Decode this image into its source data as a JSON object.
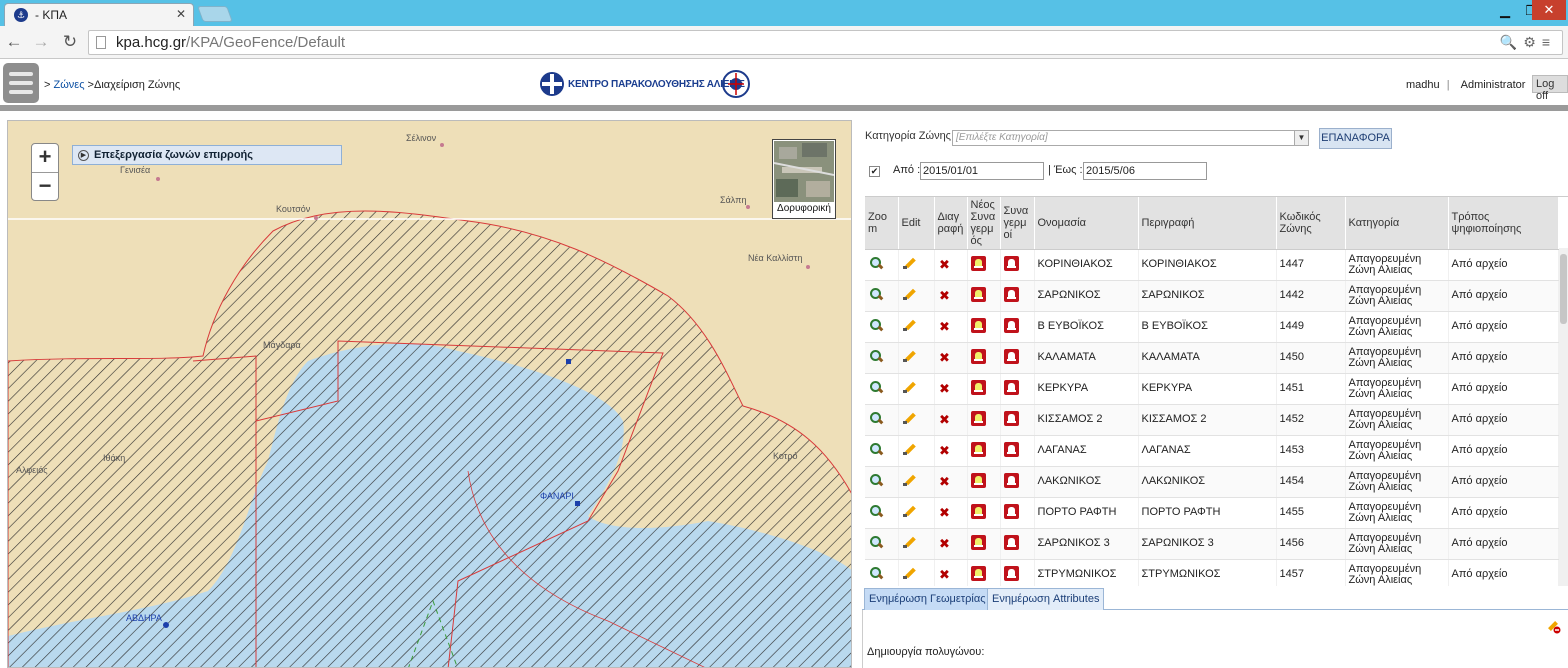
{
  "browser": {
    "tab_title": "- ΚΠΑ",
    "tab_favicon": "⚓",
    "tab_close": "✕",
    "win_min": "▁",
    "win_max": "❐",
    "win_close": "✕",
    "url_host": "kpa.hcg.gr",
    "url_path": "/KPA/GeoFence/Default",
    "back": "←",
    "forward": "→",
    "reload": "↻",
    "url_icons": "🔍⚙≡"
  },
  "header": {
    "breadcrumb_sep1": "> ",
    "breadcrumb_link": "Ζώνες",
    "breadcrumb_sep2": " >",
    "breadcrumb_current": "Διαχείριση Ζώνης",
    "logo_text": "ΚΕΝΤΡΟ ΠΑΡΑΚΟΛΟΥΘΗΣΗΣ ΑΛΙΕΙΑΣ",
    "user": "madhu",
    "role": "Administrator",
    "logoff": "Log off"
  },
  "map": {
    "zoom_in": "+",
    "zoom_out": "−",
    "layer_panel_label": "Επεξεργασία ζωνών επιρροής",
    "layer_panel_icon": "▶",
    "satellite_label": "Δορυφορική",
    "place_labels": [
      "Σέλινον",
      "Γενισέα",
      "Κουτσόν",
      "Σάλπη",
      "Νέα Καλλίστη",
      "Μάγδαρα",
      "Ιθάκη",
      "Αλφειός",
      "Κοτρό",
      "ΦΑΝΑΡΙ",
      "ΑΒΔΗΡΑ"
    ],
    "colors": {
      "land": "#eedfb8",
      "sea": "#b9d9ee",
      "zone_line": "#d83a3a",
      "hatch": "#2a2a2a"
    }
  },
  "panel": {
    "category_label": "Κατηγορία Ζώνης:",
    "category_placeholder": "[Επιλέξτε Κατηγορία]",
    "category_dd": "▼",
    "reset_label": "ΕΠΑΝΑΦΟΡΑ",
    "checkbox_mark": "✔",
    "from_label": "Από :",
    "from_value": "2015/01/01",
    "to_label": "| Έως :",
    "to_value": "2015/5/06",
    "columns": [
      "Zoo m",
      "Edit",
      "Διαγ ραφή",
      "Νέος Συνα γερμ ός",
      "Συνα γερμ οί",
      "Ονομασία",
      "Περιγραφή",
      "Κωδικός Ζώνης",
      "Κατηγορία",
      "Τρόπος ψηφιοποίησης"
    ],
    "rows": [
      {
        "name": "ΚΟΡΙΝΘΙΑΚΟΣ",
        "desc": "ΚΟΡΙΝΘΙΑΚΟΣ",
        "code": "1447",
        "category": "Απαγορευμένη Ζώνη Αλιείας",
        "method": "Από αρχείο"
      },
      {
        "name": "ΣΑΡΩΝΙΚΟΣ",
        "desc": "ΣΑΡΩΝΙΚΟΣ",
        "code": "1442",
        "category": "Απαγορευμένη Ζώνη Αλιείας",
        "method": "Από αρχείο"
      },
      {
        "name": "Β ΕΥΒΟΪΚΟΣ",
        "desc": "Β ΕΥΒΟΪΚΟΣ",
        "code": "1449",
        "category": "Απαγορευμένη Ζώνη Αλιείας",
        "method": "Από αρχείο"
      },
      {
        "name": "ΚΑΛΑΜΑΤΑ",
        "desc": "ΚΑΛΑΜΑΤΑ",
        "code": "1450",
        "category": "Απαγορευμένη Ζώνη Αλιείας",
        "method": "Από αρχείο"
      },
      {
        "name": "ΚΕΡΚΥΡΑ",
        "desc": "ΚΕΡΚΥΡΑ",
        "code": "1451",
        "category": "Απαγορευμένη Ζώνη Αλιείας",
        "method": "Από αρχείο"
      },
      {
        "name": "ΚΙΣΣΑΜΟΣ 2",
        "desc": "ΚΙΣΣΑΜΟΣ 2",
        "code": "1452",
        "category": "Απαγορευμένη Ζώνη Αλιείας",
        "method": "Από αρχείο"
      },
      {
        "name": "ΛΑΓΑΝΑΣ",
        "desc": "ΛΑΓΑΝΑΣ",
        "code": "1453",
        "category": "Απαγορευμένη Ζώνη Αλιείας",
        "method": "Από αρχείο"
      },
      {
        "name": "ΛΑΚΩΝΙΚΟΣ",
        "desc": "ΛΑΚΩΝΙΚΟΣ",
        "code": "1454",
        "category": "Απαγορευμένη Ζώνη Αλιείας",
        "method": "Από αρχείο"
      },
      {
        "name": "ΠΟΡΤΟ ΡΑΦΤΗ",
        "desc": "ΠΟΡΤΟ ΡΑΦΤΗ",
        "code": "1455",
        "category": "Απαγορευμένη Ζώνη Αλιείας",
        "method": "Από αρχείο"
      },
      {
        "name": "ΣΑΡΩΝΙΚΟΣ 3",
        "desc": "ΣΑΡΩΝΙΚΟΣ 3",
        "code": "1456",
        "category": "Απαγορευμένη Ζώνη Αλιείας",
        "method": "Από αρχείο"
      },
      {
        "name": "ΣΤΡΥΜΩΝΙΚΟΣ",
        "desc": "ΣΤΡΥΜΩΝΙΚΟΣ",
        "code": "1457",
        "category": "Απαγορευμένη Ζώνη Αλιείας",
        "method": "Από αρχείο"
      }
    ],
    "delete_glyph": "✖",
    "tabs": [
      "Ενημέρωση Γεωμετρίας",
      "Ενημέρωση Attributes"
    ],
    "create_polygon_label": "Δημιουργία πολυγώνου:"
  }
}
